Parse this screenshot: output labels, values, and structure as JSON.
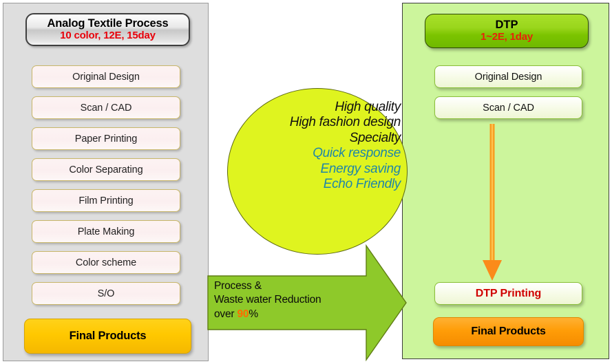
{
  "colors": {
    "left_panel_bg": "#dedede",
    "right_panel_bg": "#ccf59c",
    "ellipse_fill": "#dff41f",
    "green_arrow_fill": "#8ec92a",
    "orange_arrow": "#f79a1e",
    "red_text": "#e8000a",
    "teal_text": "#1f86a8",
    "gold_final": "#ffc800",
    "orange_final": "#ff9d08"
  },
  "left": {
    "title": {
      "line1": "Analog Textile Process",
      "line2": "10 color, 12E, 15day"
    },
    "steps": [
      "Original Design",
      "Scan / CAD",
      "Paper Printing",
      "Color Separating",
      "Film Printing",
      "Plate Making",
      "Color scheme",
      "S/O"
    ],
    "final": "Final Products"
  },
  "right": {
    "title": {
      "line1": "DTP",
      "line2": "1~2E, 1day"
    },
    "steps": [
      "Original Design",
      "Scan / CAD"
    ],
    "printing": "DTP Printing",
    "final": "Final Products"
  },
  "ellipse": {
    "lines": [
      {
        "text": "High quality",
        "style": "black"
      },
      {
        "text": "High fashion design",
        "style": "black"
      },
      {
        "text": "Specialty",
        "style": "black"
      },
      {
        "text": "Quick response",
        "style": "teal"
      },
      {
        "text": "Energy saving",
        "style": "teal"
      },
      {
        "text": "Echo Friendly",
        "style": "teal"
      }
    ]
  },
  "green_arrow": {
    "line1": "Process &",
    "line2": "Waste water Reduction",
    "line3_prefix": "over ",
    "line3_value": "90",
    "line3_suffix": "%"
  }
}
